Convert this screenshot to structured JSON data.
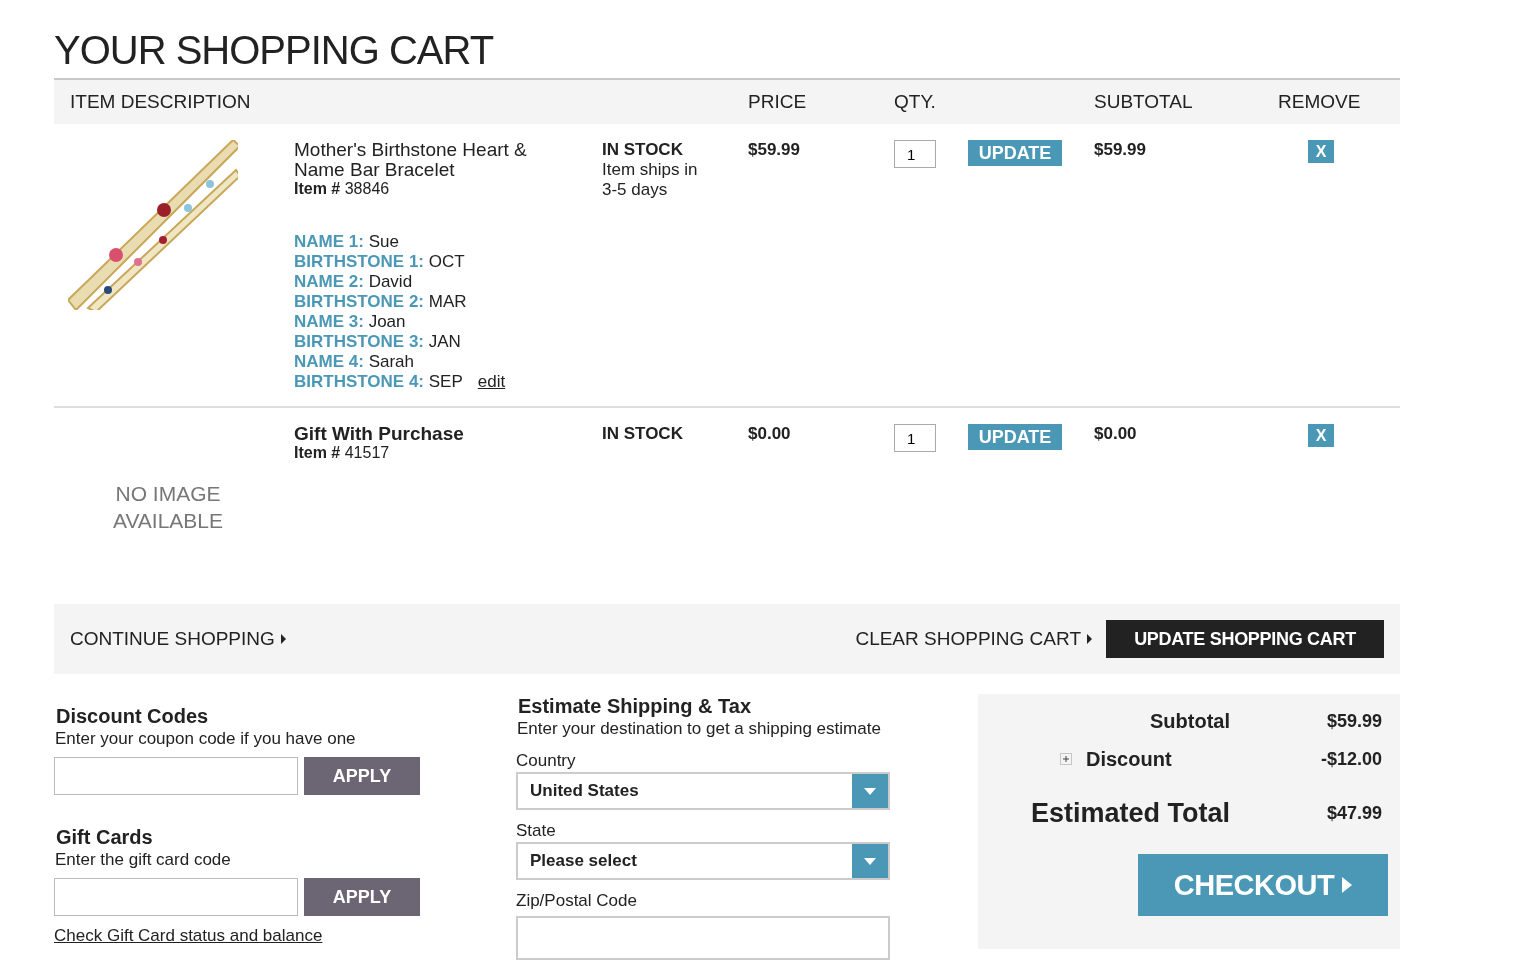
{
  "title": "YOUR SHOPPING CART",
  "columns": [
    {
      "label": "ITEM DESCRIPTION",
      "kind": "desc"
    },
    {
      "label": "PRICE",
      "kind": "price"
    },
    {
      "label": "QTY.",
      "kind": "qty"
    },
    {
      "label": "SUBTOTAL",
      "kind": "subtotal"
    },
    {
      "label": "REMOVE",
      "kind": "remove"
    }
  ],
  "items": [
    {
      "name": "Mother's Birthstone Heart & Name Bar Bracelet",
      "item_label": "Item #",
      "item_number": "38846",
      "stock": "IN STOCK",
      "stock_note": "Item ships in 3-5 days",
      "price": "$59.99",
      "qty": "1",
      "update": "UPDATE",
      "subtotal": "$59.99",
      "remove": "X",
      "edit": "edit",
      "options": [
        {
          "label": "NAME 1:",
          "value": "Sue"
        },
        {
          "label": "BIRTHSTONE 1:",
          "value": "OCT"
        },
        {
          "label": "NAME 2:",
          "value": "David"
        },
        {
          "label": "BIRTHSTONE 2:",
          "value": "MAR"
        },
        {
          "label": "NAME 3:",
          "value": "Joan"
        },
        {
          "label": "BIRTHSTONE 3:",
          "value": "JAN"
        },
        {
          "label": "NAME 4:",
          "value": "Sarah"
        },
        {
          "label": "BIRTHSTONE 4:",
          "value": "SEP"
        }
      ]
    },
    {
      "image": {
        "kind": "none",
        "text": "NO IMAGE AVAILABLE"
      },
      "name": "Gift With Purchase",
      "item_label": "Item #",
      "item_number": "41517",
      "stock": "IN STOCK",
      "price": "$0.00",
      "qty": "1",
      "update": "UPDATE",
      "subtotal": "$0.00",
      "remove": "X"
    }
  ],
  "actions": {
    "continue": "CONTINUE SHOPPING",
    "clear": "CLEAR SHOPPING CART",
    "update_cart": "UPDATE SHOPPING CART"
  },
  "discount": {
    "title": "Discount Codes",
    "hint": "Enter your coupon code if you have one",
    "button": "APPLY"
  },
  "gift_cards": {
    "title": "Gift Cards",
    "hint": "Enter the gift card code",
    "button": "APPLY",
    "link": "Check Gift Card status and balance"
  },
  "shipping": {
    "title": "Estimate Shipping & Tax",
    "hint": "Enter your destination to get a shipping estimate",
    "fields": [
      {
        "label": "Country",
        "kind": "select",
        "value": "United States"
      },
      {
        "label": "State",
        "kind": "select",
        "value": "Please select"
      },
      {
        "label": "Zip/Postal Code",
        "kind": "text"
      }
    ]
  },
  "totals": {
    "lines": [
      {
        "label": "Subtotal",
        "value": "$59.99",
        "kind": "plain"
      },
      {
        "label": "Discount",
        "value": "-$12.00",
        "kind": "expandable",
        "expanded": false
      },
      {
        "label": "Estimated Total",
        "value": "$47.99",
        "kind": "grand"
      }
    ],
    "checkout": "CHECKOUT"
  }
}
